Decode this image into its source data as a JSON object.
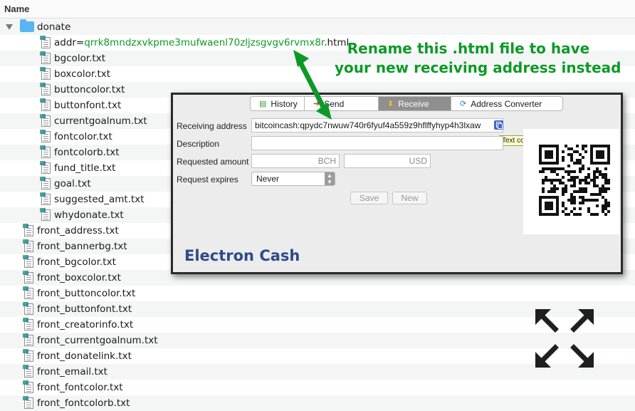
{
  "header": {
    "column_label": "Name"
  },
  "folder": {
    "name": "donate"
  },
  "addr_file": {
    "prefix": "addr=",
    "address": "qrrk8mndzxvkpme3mufwaenl70zljzsgvgv6rvmx8r",
    "suffix": ".html"
  },
  "folder_files": [
    "bgcolor.txt",
    "boxcolor.txt",
    "buttoncolor.txt",
    "buttonfont.txt",
    "currentgoalnum.txt",
    "fontcolor.txt",
    "fontcolorb.txt",
    "fund_title.txt",
    "goal.txt",
    "suggested_amt.txt",
    "whydonate.txt"
  ],
  "root_files": [
    "front_address.txt",
    "front_bannerbg.txt",
    "front_bgcolor.txt",
    "front_boxcolor.txt",
    "front_buttoncolor.txt",
    "front_buttonfont.txt",
    "front_creatorinfo.txt",
    "front_currentgoalnum.txt",
    "front_donatelink.txt",
    "front_email.txt",
    "front_fontcolor.txt",
    "front_fontcolorb.txt"
  ],
  "annotation": {
    "line1": "Rename this .html file to have",
    "line2": "your new receiving address instead"
  },
  "colors": {
    "annotation": "#0c9a26",
    "brand": "#2e4a8a"
  },
  "electron_cash": {
    "tabs": [
      {
        "label": "History",
        "icon": "history-icon",
        "active": false
      },
      {
        "label": "Send",
        "icon": "send-icon",
        "active": false
      },
      {
        "label": "Receive",
        "icon": "receive-icon",
        "active": true
      },
      {
        "label": "Address Converter",
        "icon": "converter-icon",
        "active": false
      }
    ],
    "receiving_address_label": "Receiving address",
    "receiving_address_value": "bitcoincash:qpydc7nwuw740r6fyuf4a559z9hflffyhyp4h3lxaw",
    "description_label": "Description",
    "requested_amount_label": "Requested amount",
    "bch_placeholder": "BCH",
    "usd_placeholder": "USD",
    "request_expires_label": "Request expires",
    "expires_value": "Never",
    "save_label": "Save",
    "new_label": "New",
    "tooltip": "Text copied to clipboard",
    "brand": "Electron Cash"
  }
}
